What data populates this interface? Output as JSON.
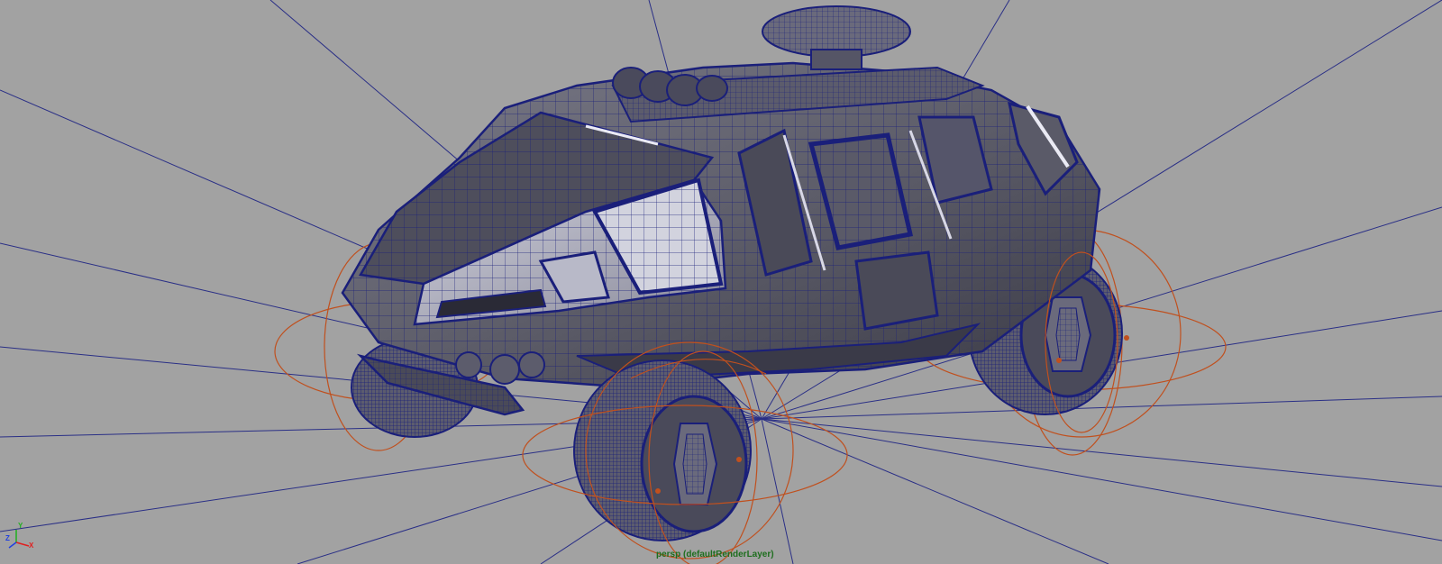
{
  "viewport": {
    "camera_label": "persp (defaultRenderLayer)"
  },
  "axis_gizmo": {
    "x_label": "X",
    "y_label": "Y",
    "z_label": "Z"
  },
  "colors": {
    "background": "#a2a2a2",
    "wireframe": "#1a1f7a",
    "light_lines": "#2a2f86",
    "controller_curves": "#c0501e",
    "axis_x": "#e02020",
    "axis_y": "#20b020",
    "axis_z": "#2040e0",
    "label_text": "#1e6e1e"
  },
  "icons": {
    "axis": "xyz-axis-gizmo-icon"
  }
}
